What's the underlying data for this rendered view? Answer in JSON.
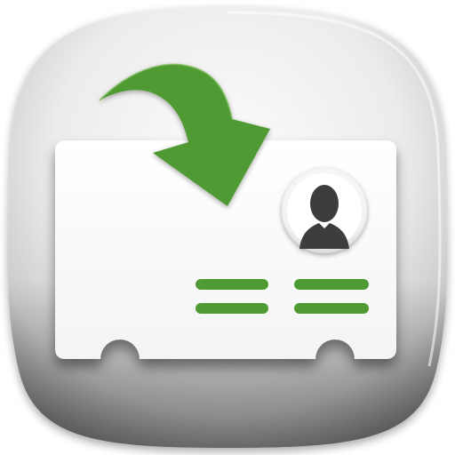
{
  "icon": {
    "semantic": "contact-card-import-icon",
    "parts": [
      "squircle-background",
      "id-card",
      "download-arrow",
      "avatar",
      "info-lines"
    ]
  },
  "colors": {
    "accent_green": "#4f9a32",
    "accent_green_dark": "#3f8226",
    "card_white": "#ffffff",
    "avatar_dark": "#3e3e3e",
    "background_light": "#f6f6f6",
    "background_shadow": "#7d7d7d"
  }
}
